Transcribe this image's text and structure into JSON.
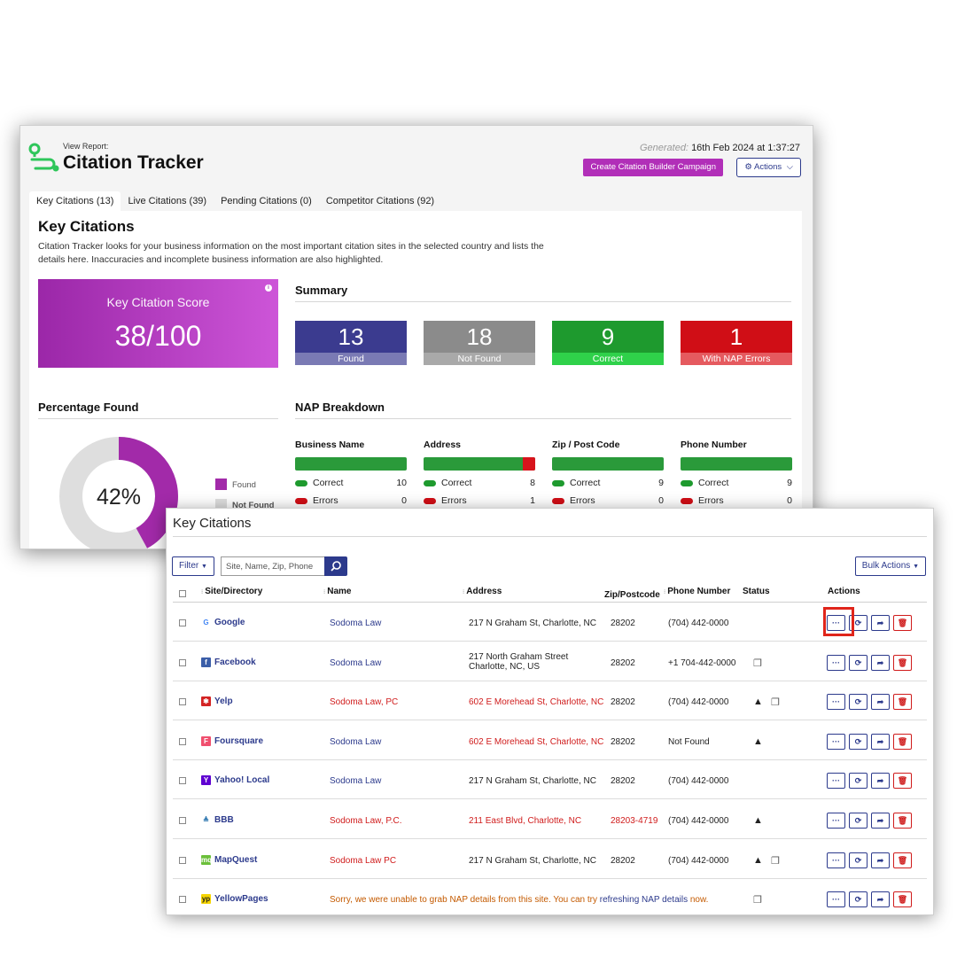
{
  "header": {
    "view_report": "View Report:",
    "title": "Citation Tracker",
    "generated_label": "Generated:",
    "generated_value": "16th Feb 2024 at 1:37:27",
    "create_campaign_button": "Create Citation Builder Campaign",
    "actions_button": "Actions"
  },
  "tabs": [
    {
      "label": "Key Citations (13)",
      "active": true
    },
    {
      "label": "Live Citations (39)"
    },
    {
      "label": "Pending Citations (0)"
    },
    {
      "label": "Competitor Citations (92)"
    }
  ],
  "key_citations": {
    "heading": "Key Citations",
    "description": "Citation Tracker looks for your business information on the most important citation sites in the selected country and lists the details here. Inaccuracies and incomplete business information are also highlighted.",
    "score_label": "Key Citation Score",
    "score_value": "38/100"
  },
  "summary": {
    "title": "Summary",
    "boxes": [
      {
        "value": "13",
        "label": "Found",
        "color": "#3b3b8f",
        "label_color": "#7a7ab4"
      },
      {
        "value": "18",
        "label": "Not Found",
        "color": "#8b8b8b",
        "label_color": "#a9a9a9"
      },
      {
        "value": "9",
        "label": "Correct",
        "color": "#1e9a2e",
        "label_color": "#2fd14a"
      },
      {
        "value": "1",
        "label": "With NAP Errors",
        "color": "#d00e16",
        "label_color": "#e55a5f"
      }
    ]
  },
  "percentage_found": {
    "title": "Percentage Found",
    "value": "42%",
    "fraction": 0.42,
    "legend_found": "Found",
    "legend_not_found": "Not Found",
    "found_color": "#a22aa9",
    "not_found_color": "#dedede"
  },
  "nap_breakdown": {
    "title": "NAP Breakdown",
    "correct_label": "Correct",
    "errors_label": "Errors",
    "columns": [
      {
        "title": "Business Name",
        "correct": "10",
        "errors": "0",
        "error_fraction": 0
      },
      {
        "title": "Address",
        "correct": "8",
        "errors": "1",
        "error_fraction": 0.11
      },
      {
        "title": "Zip / Post Code",
        "correct": "9",
        "errors": "0",
        "error_fraction": 0
      },
      {
        "title": "Phone Number",
        "correct": "9",
        "errors": "0",
        "error_fraction": 0
      }
    ]
  },
  "table_window": {
    "title": "Key Citations",
    "filter_button": "Filter",
    "search_placeholder": "Site, Name, Zip, Phone",
    "bulk_actions_button": "Bulk Actions",
    "columns": {
      "site": "Site/Directory",
      "name": "Name",
      "address": "Address",
      "zip": "Zip/Postcode",
      "phone": "Phone Number",
      "status": "Status",
      "actions": "Actions"
    },
    "rows": [
      {
        "site": "Google",
        "icon": "google-icon",
        "name": "Sodoma Law",
        "name_error": false,
        "address": "217 N Graham St, Charlotte, NC",
        "address_error": false,
        "zip": "28202",
        "zip_error": false,
        "phone": "(704) 442-0000",
        "warning": false,
        "duplicate": false
      },
      {
        "site": "Facebook",
        "icon": "facebook-icon",
        "name": "Sodoma Law",
        "name_error": false,
        "address": "217 North Graham Street Charlotte, NC, US",
        "address_error": false,
        "zip": "28202",
        "zip_error": false,
        "phone": "+1 704-442-0000",
        "warning": false,
        "duplicate": true
      },
      {
        "site": "Yelp",
        "icon": "yelp-icon",
        "name": "Sodoma Law, PC",
        "name_error": true,
        "address": "602 E Morehead St, Charlotte, NC",
        "address_error": true,
        "zip": "28202",
        "zip_error": false,
        "phone": "(704) 442-0000",
        "warning": true,
        "duplicate": true
      },
      {
        "site": "Foursquare",
        "icon": "foursquare-icon",
        "name": "Sodoma Law",
        "name_error": false,
        "address": "602 E Morehead St, Charlotte, NC",
        "address_error": true,
        "zip": "28202",
        "zip_error": false,
        "phone": "Not Found",
        "warning": true,
        "duplicate": false
      },
      {
        "site": "Yahoo! Local",
        "icon": "yahoo-icon",
        "name": "Sodoma Law",
        "name_error": false,
        "address": "217 N Graham St, Charlotte, NC",
        "address_error": false,
        "zip": "28202",
        "zip_error": false,
        "phone": "(704) 442-0000",
        "warning": false,
        "duplicate": false
      },
      {
        "site": "BBB",
        "icon": "bbb-icon",
        "name": "Sodoma Law, P.C.",
        "name_error": true,
        "address": "211 East Blvd, Charlotte, NC",
        "address_error": true,
        "zip": "28203-4719",
        "zip_error": true,
        "phone": "(704) 442-0000",
        "warning": true,
        "duplicate": false
      },
      {
        "site": "MapQuest",
        "icon": "mapquest-icon",
        "name": "Sodoma Law PC",
        "name_error": true,
        "address": "217 N Graham St, Charlotte, NC",
        "address_error": false,
        "zip": "28202",
        "zip_error": false,
        "phone": "(704) 442-0000",
        "warning": true,
        "duplicate": true
      },
      {
        "site": "YellowPages",
        "icon": "yellowpages-icon",
        "sorry_before": "Sorry, we were unable to grab NAP details from this site. You can try ",
        "sorry_link": "refreshing NAP details",
        "sorry_after": " now.",
        "duplicate": true
      }
    ]
  }
}
